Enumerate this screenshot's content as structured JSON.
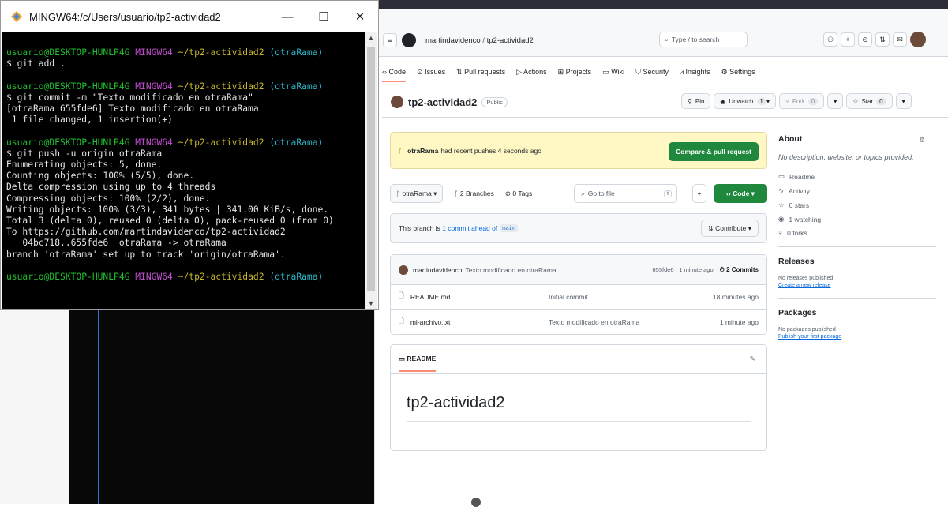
{
  "terminal": {
    "title": "MINGW64:/c/Users/usuario/tp2-actividad2",
    "controls": {
      "minimize": "—",
      "maximize": "☐",
      "close": "✕"
    },
    "prompt_user": "usuario@DESKTOP-HUNLP4G",
    "prompt_sys": "MINGW64",
    "prompt_path": "~/tp2-actividad2",
    "prompt_branch": "(otraRama)",
    "blocks": [
      {
        "cmd": "$ git add .",
        "output": []
      },
      {
        "cmd": "$ git commit -m \"Texto modificado en otraRama\"",
        "output": [
          "[otraRama 655fde6] Texto modificado en otraRama",
          " 1 file changed, 1 insertion(+)"
        ]
      },
      {
        "cmd": "$ git push -u origin otraRama",
        "output": [
          "Enumerating objects: 5, done.",
          "Counting objects: 100% (5/5), done.",
          "Delta compression using up to 4 threads",
          "Compressing objects: 100% (2/2), done.",
          "Writing objects: 100% (3/3), 341 bytes | 341.00 KiB/s, done.",
          "Total 3 (delta 0), reused 0 (delta 0), pack-reused 0 (from 0)",
          "To https://github.com/martindavidenco/tp2-actividad2",
          "   04bc718..655fde6  otraRama -> otraRama",
          "branch 'otraRama' set up to track 'origin/otraRama'."
        ]
      }
    ]
  },
  "github": {
    "owner": "martindavidenco",
    "repo": "tp2-actividad2",
    "search_placeholder": "Type / to search",
    "search_key": "/",
    "nav": [
      "Code",
      "Issues",
      "Pull requests",
      "Actions",
      "Projects",
      "Wiki",
      "Security",
      "Insights",
      "Settings"
    ],
    "visibility": "Public",
    "pin": "Pin",
    "unwatch": "Unwatch",
    "unwatch_count": "1",
    "fork": "Fork",
    "fork_count": "0",
    "star": "Star",
    "star_count": "0",
    "flash_branch": "otraRama",
    "flash_text": "had recent pushes 4 seconds ago",
    "compare_btn": "Compare & pull request",
    "branch": "otraRama",
    "branches": "2 Branches",
    "tags": "0 Tags",
    "goto_placeholder": "Go to file",
    "goto_key": "t",
    "code_btn": "Code",
    "ahead_pre": "This branch is",
    "ahead_link": "1 commit ahead of",
    "ahead_main": "main",
    "ahead_post": ".",
    "contribute": "Contribute",
    "commit_author": "martindavidenco",
    "commit_msg": "Texto modificado en otraRama",
    "commit_meta": "655fde6 · 1 minute ago",
    "commits_count": "2 Commits",
    "files": [
      {
        "name": "README.md",
        "msg": "Initial commit",
        "date": "18 minutes ago"
      },
      {
        "name": "mi-archivo.txt",
        "msg": "Texto modificado en otraRama",
        "date": "1 minute ago"
      }
    ],
    "readme_tab": "README",
    "readme_h1": "tp2-actividad2",
    "about": {
      "title": "About",
      "desc": "No description, website, or topics provided.",
      "items": [
        "Readme",
        "Activity",
        "0 stars",
        "1 watching",
        "0 forks"
      ]
    },
    "releases": {
      "title": "Releases",
      "none": "No releases published",
      "link": "Create a new release"
    },
    "packages": {
      "title": "Packages",
      "none": "No packages published",
      "link": "Publish your first package"
    }
  }
}
